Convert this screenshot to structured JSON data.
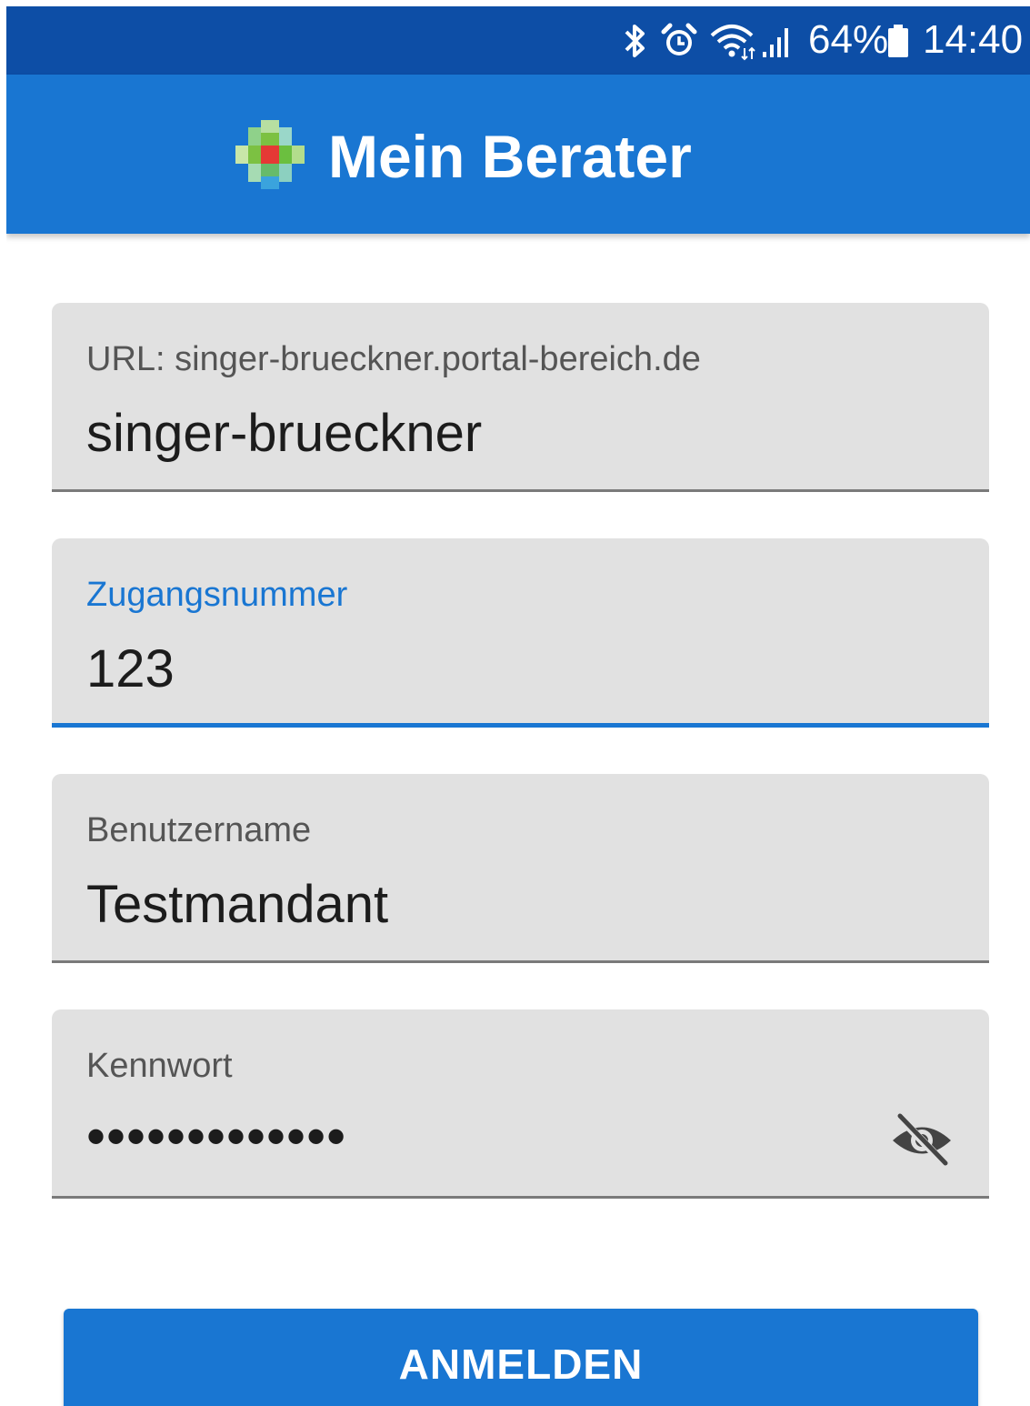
{
  "status_bar": {
    "battery_percent": "64%",
    "time": "14:40",
    "icons": [
      "bluetooth-icon",
      "alarm-icon",
      "wifi-icon",
      "cell-signal-icon",
      "battery-icon"
    ]
  },
  "app_bar": {
    "title": "Mein Berater",
    "logo_icon": "pixel-cross-logo"
  },
  "form": {
    "url_field": {
      "label": "URL: singer-brueckner.portal-bereich.de",
      "value": "singer-brueckner"
    },
    "access_number_field": {
      "label": "Zugangsnummer",
      "value": "123",
      "focused": true
    },
    "username_field": {
      "label": "Benutzername",
      "value": "Testmandant"
    },
    "password_field": {
      "label": "Kennwort",
      "masked_value": "•••••••••••••",
      "toggle_icon": "visibility-off-icon"
    },
    "submit_label": "ANMELDEN"
  },
  "colors": {
    "status_bar": "#0d4ea6",
    "primary": "#1976d2",
    "field_background": "#e1e1e1",
    "logo_red": "#e53935",
    "logo_green": "#7cc142",
    "logo_blue": "#3aa3dd"
  }
}
